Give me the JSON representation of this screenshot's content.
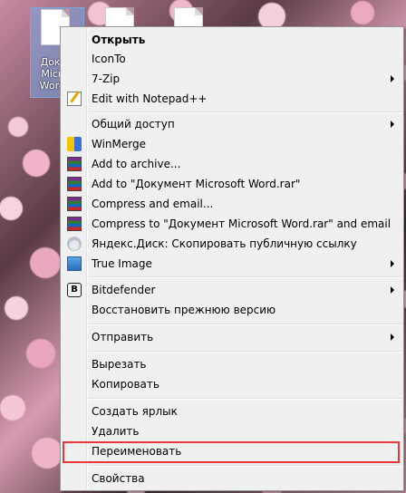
{
  "desktop": {
    "icon_label_lines": [
      "Докум",
      "Micros",
      "Word.d"
    ]
  },
  "menu": {
    "items": [
      {
        "label": "Открыть",
        "bold": true
      },
      {
        "label": "IconTo"
      },
      {
        "label": "7-Zip",
        "submenu": true
      },
      {
        "label": "Edit with Notepad++",
        "icon": "notepad-icon"
      },
      {
        "label": "Общий доступ",
        "submenu": true
      },
      {
        "label": "WinMerge",
        "icon": "winmerge-icon"
      },
      {
        "label": "Add to archive...",
        "icon": "winrar-icon"
      },
      {
        "label": "Add to \"Документ Microsoft Word.rar\"",
        "icon": "winrar-icon"
      },
      {
        "label": "Compress and email...",
        "icon": "winrar-icon"
      },
      {
        "label": "Compress to \"Документ Microsoft Word.rar\" and email",
        "icon": "winrar-icon"
      },
      {
        "label": "Яндекс.Диск: Скопировать публичную ссылку",
        "icon": "yandex-disk-icon"
      },
      {
        "label": "True Image",
        "icon": "true-image-icon",
        "submenu": true
      },
      {
        "label": "Bitdefender",
        "icon": "bitdefender-icon",
        "submenu": true
      },
      {
        "label": "Восстановить прежнюю версию"
      },
      {
        "label": "Отправить",
        "submenu": true
      },
      {
        "label": "Вырезать"
      },
      {
        "label": "Копировать"
      },
      {
        "label": "Создать ярлык"
      },
      {
        "label": "Удалить"
      },
      {
        "label": "Переименовать",
        "highlighted": true
      },
      {
        "label": "Свойства"
      }
    ]
  },
  "colors": {
    "menu_background": "#f0f0f0",
    "highlight_border": "#e8373c",
    "selection": "#7aa7d8"
  }
}
